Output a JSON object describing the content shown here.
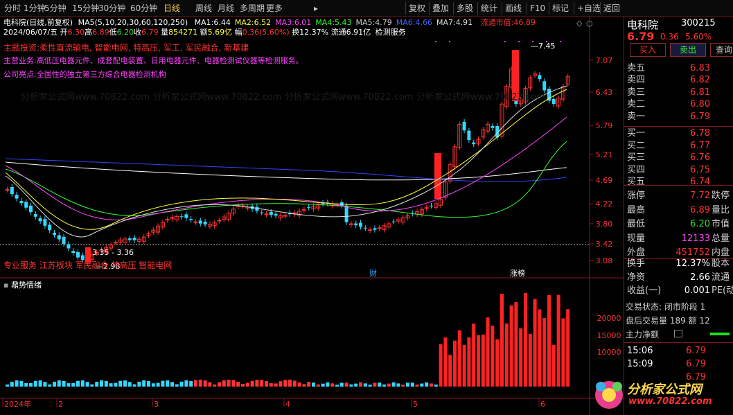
{
  "toolbar": {
    "left": [
      "分时",
      "1分钟",
      "5分钟",
      "15分钟",
      "30分钟",
      "60分钟",
      "日线",
      "周线",
      "月线",
      "多周期",
      "更多"
    ],
    "active": "日线",
    "right": [
      "复权",
      "叠加",
      "多股",
      "统计",
      "画线",
      "F10",
      "标记",
      "+自选",
      "返回"
    ]
  },
  "header": {
    "stock": "电科院(日线,前复权)",
    "ma_params": "MA5(5,10,20,30,60,120,250)",
    "ma": [
      {
        "label": "MA1:",
        "value": "6.44",
        "color": "#ffffff"
      },
      {
        "label": "MA2:",
        "value": "6.52",
        "color": "#ffff33"
      },
      {
        "label": "MA3:",
        "value": "6.01",
        "color": "#ff44ff"
      },
      {
        "label": "MA4:",
        "value": "5.43",
        "color": "#33ff33"
      },
      {
        "label": "MA5:",
        "value": "4.79",
        "color": "#cccccc"
      },
      {
        "label": "MA6:",
        "value": "4.66",
        "color": "#4466ff"
      },
      {
        "label": "MA7:",
        "value": "4.91",
        "color": "#dddddd"
      }
    ],
    "float_cap_label": "流通市值:",
    "float_cap_value": "46.89",
    "date": "2024/06/07/五",
    "ohlc": [
      {
        "label": "开",
        "value": "6.30",
        "color": "#ff3333"
      },
      {
        "label": "高",
        "value": "6.89",
        "color": "#ff3333"
      },
      {
        "label": "低",
        "value": "6.20",
        "color": "#33dd33"
      },
      {
        "label": "收",
        "value": "6.79",
        "color": "#ff3333"
      }
    ],
    "vol_label": "量",
    "vol_value": "854271",
    "amt_label": "额",
    "amt_value": "5.69亿",
    "range_label": "幅",
    "range_value": "0.36(5.60%)",
    "turn_label": "换",
    "turn_value": "12.37%",
    "float_label": "流通",
    "float_value": "6.91亿",
    "sector": "检测服务"
  },
  "themes": {
    "line1": "主题投资:柔性直流输电, 智能电网, 特高压, 军工, 军民融合, 新基建",
    "line2": "主营业务:高低压电器元件、成套配电装置、日用电器元件、电器检测试仪器等检测服务。",
    "line3": "公司亮点:全国性的独立第三方综合电器检测机构",
    "bottom": "专业服务 江苏板块 军民融合 特高压 智能电网"
  },
  "price_axis": [
    "7.07",
    "6.43",
    "5.79",
    "5.21",
    "4.69",
    "4.22",
    "3.80",
    "3.42",
    "3.08"
  ],
  "annotations": {
    "high": "7.45",
    "low": "2.98",
    "low_range": "3.35 - 3.36",
    "marker_cai": "财",
    "marker_zhang": "涨榜"
  },
  "sub": {
    "title": "鼎势情绪",
    "axis": [
      "20000",
      "15000",
      "10000"
    ]
  },
  "dates": [
    "2024年",
    "2",
    "3",
    "4",
    "5",
    "6"
  ],
  "quote": {
    "name": "电科院",
    "code": "300215",
    "price": "6.79",
    "change": "0.36",
    "pct": "5.60%",
    "buy_btn": "买入",
    "sell_btn": "卖出",
    "query_btn": "查询",
    "asks": [
      {
        "label": "卖五",
        "price": "6.83"
      },
      {
        "label": "卖四",
        "price": "6.82"
      },
      {
        "label": "卖三",
        "price": "6.81"
      },
      {
        "label": "卖二",
        "price": "6.80"
      },
      {
        "label": "卖一",
        "price": "6.79"
      }
    ],
    "bids": [
      {
        "label": "买一",
        "price": "6.78"
      },
      {
        "label": "买二",
        "price": "6.77"
      },
      {
        "label": "买三",
        "price": "6.76"
      },
      {
        "label": "买四",
        "price": "6.75"
      },
      {
        "label": "买五",
        "price": "6.74"
      }
    ],
    "stats": [
      {
        "label": "涨停",
        "value": "7.72",
        "color": "#ff3333",
        "right": "跌停"
      },
      {
        "label": "最高",
        "value": "6.89",
        "color": "#ff3333",
        "right": "量比"
      },
      {
        "label": "最低",
        "value": "6.20",
        "color": "#33dd33",
        "right": "市值"
      },
      {
        "label": "现量",
        "value": "12133",
        "color": "#ff44ff",
        "right": "总量"
      },
      {
        "label": "外盘",
        "value": "451752",
        "color": "#ff3333",
        "right": "内盘"
      }
    ],
    "stats2": [
      {
        "label": "换手",
        "value": "12.37%",
        "right": "股本"
      },
      {
        "label": "净资",
        "value": "2.66",
        "right": "流通"
      },
      {
        "label": "收益(一)",
        "value": "0.001",
        "right": "PE(动"
      }
    ],
    "trade_status": "交易状态: 闭市阶段 1",
    "after_hours": "盘后交易量 189 额 12",
    "main_force": "主力净额",
    "ticks": [
      {
        "time": "15:06",
        "price": "6.79"
      },
      {
        "time": "15:09",
        "price": "6.79"
      },
      {
        "time": "",
        "price": "6.79"
      }
    ]
  },
  "logo": {
    "text": "分析家公式网",
    "url": "www.70822.com"
  }
}
